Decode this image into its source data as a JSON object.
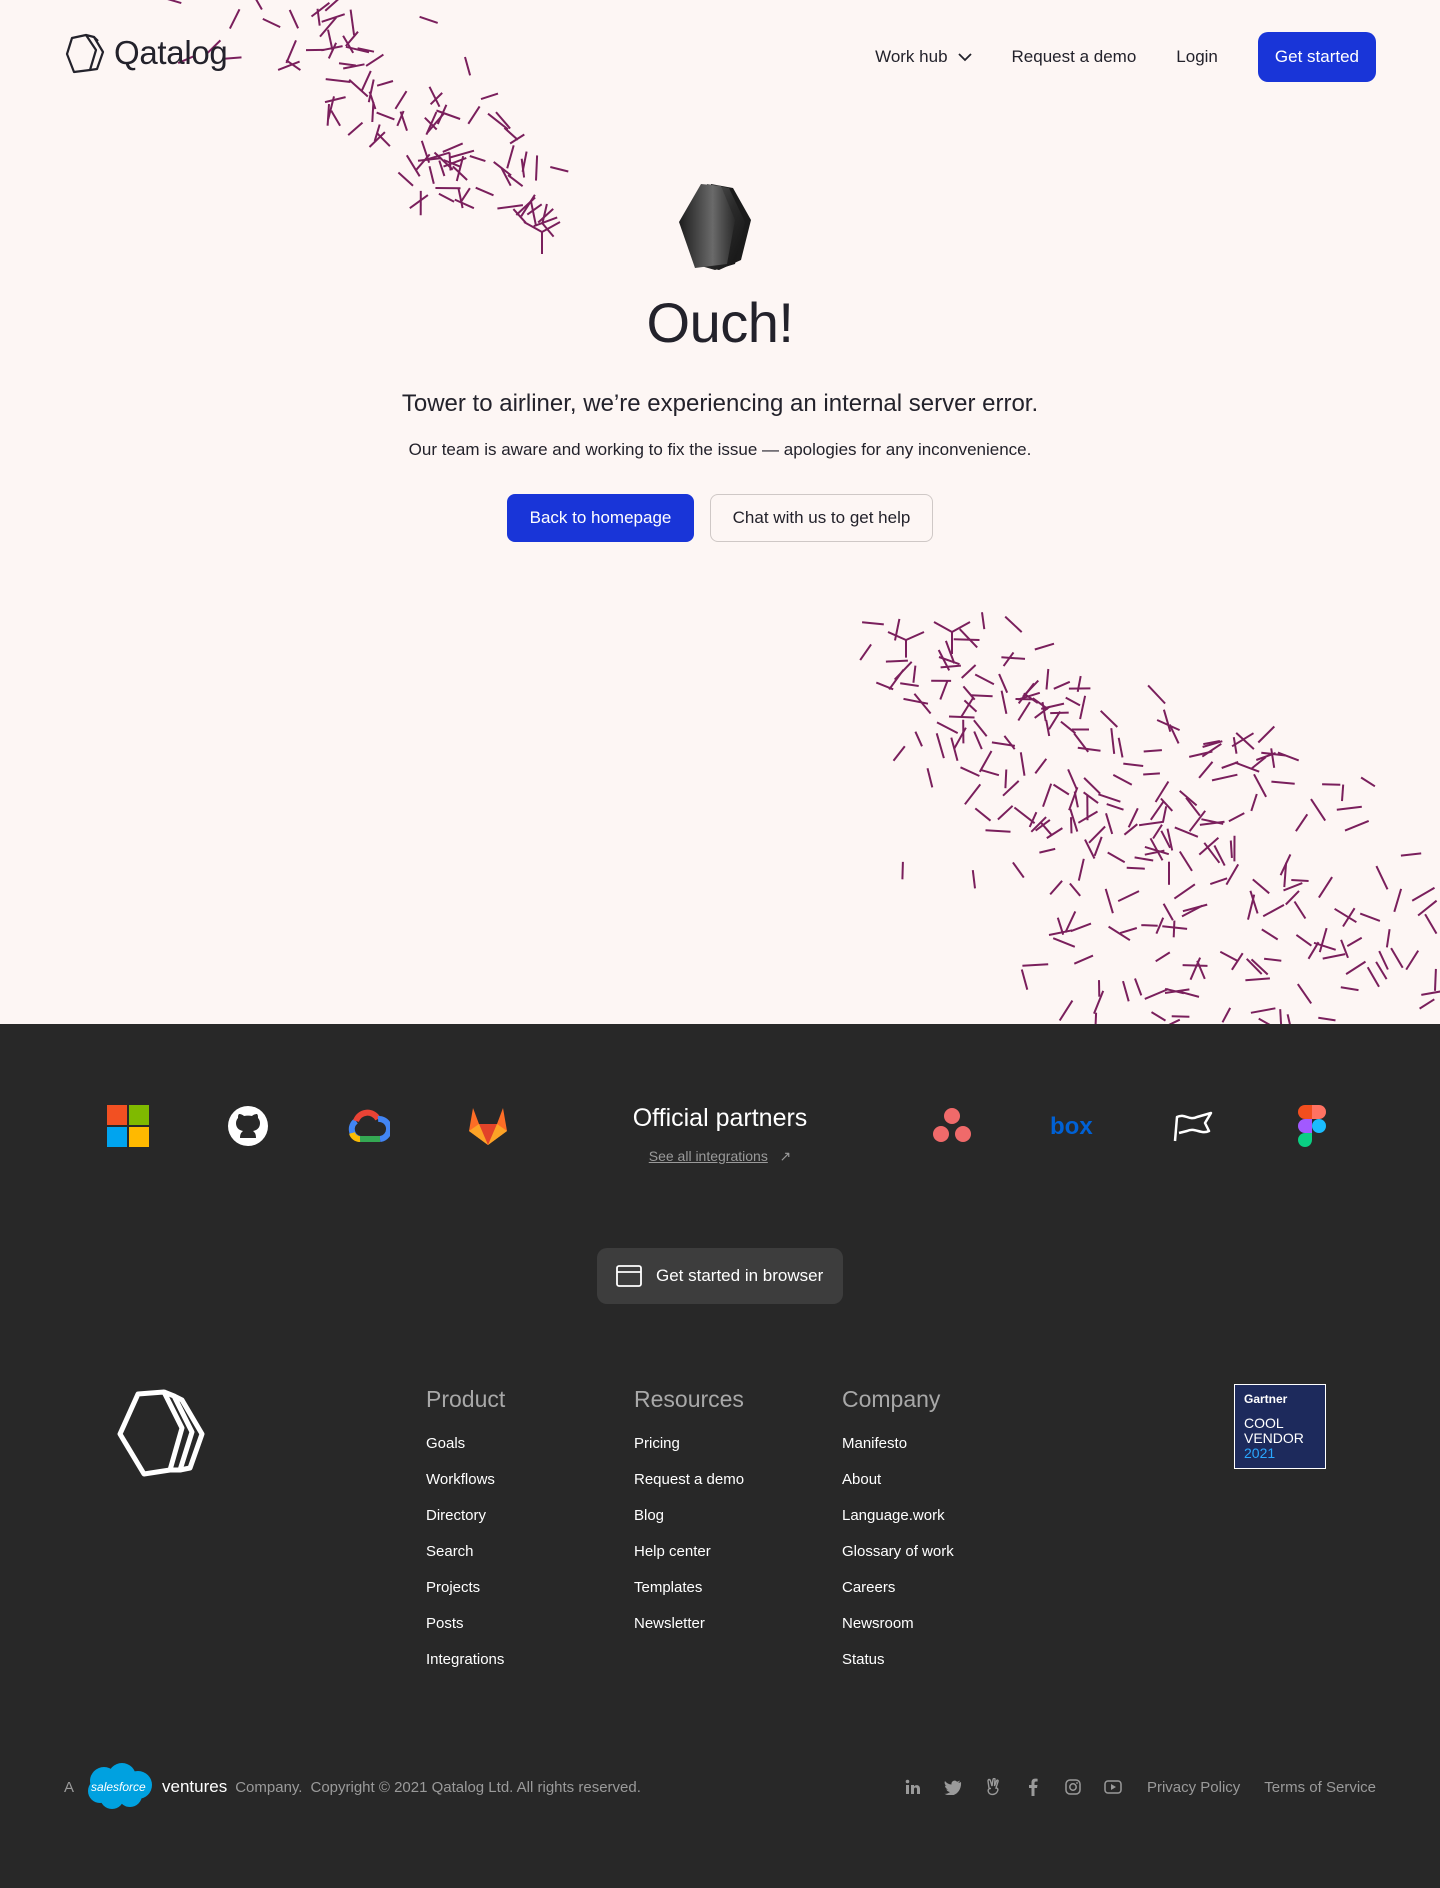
{
  "header": {
    "brand": "Qatalog",
    "nav": {
      "work_hub": "Work hub",
      "request_demo": "Request a demo",
      "login": "Login",
      "get_started": "Get started"
    }
  },
  "error": {
    "title": "Ouch!",
    "subtitle": "Tower to airliner, we’re experiencing an internal server error.",
    "description": "Our team is aware and working to fix the issue — apologies for any inconvenience.",
    "primary_action": "Back to homepage",
    "secondary_action": "Chat with us to get help"
  },
  "partners": {
    "title": "Official partners",
    "link": "See all integrations",
    "logos_left": [
      "microsoft-icon",
      "github-icon",
      "google-cloud-icon",
      "gitlab-icon"
    ],
    "logos_right": [
      "asana-icon",
      "box-icon",
      "flag-icon",
      "figma-icon"
    ]
  },
  "browser_cta": {
    "label": "Get started in browser"
  },
  "columns": {
    "product": {
      "title": "Product",
      "items": [
        "Goals",
        "Workflows",
        "Directory",
        "Search",
        "Projects",
        "Posts",
        "Integrations"
      ]
    },
    "resources": {
      "title": "Resources",
      "items": [
        "Pricing",
        "Request a demo",
        "Blog",
        "Help center",
        "Templates",
        "Newsletter"
      ]
    },
    "company": {
      "title": "Company",
      "items": [
        "Manifesto",
        "About",
        "Language.work",
        "Glossary of work",
        "Careers",
        "Newsroom",
        "Status"
      ]
    }
  },
  "gartner": {
    "brand": "Gartner",
    "line1": "COOL",
    "line2": "VENDOR",
    "year": "2021"
  },
  "bottom": {
    "prefix": "A",
    "salesforce": "salesforce",
    "ventures": "ventures",
    "company": "Company.",
    "copyright": "Copyright © 2021 Qatalog Ltd. All rights reserved.",
    "social": [
      "linkedin-icon",
      "twitter-icon",
      "angellist-icon",
      "facebook-icon",
      "instagram-icon",
      "youtube-icon"
    ],
    "privacy": "Privacy Policy",
    "terms": "Terms of Service"
  },
  "colors": {
    "accent": "#1935d8",
    "background": "#fdf6f4",
    "footer": "#282828",
    "dashes": "#7a1f5c"
  }
}
